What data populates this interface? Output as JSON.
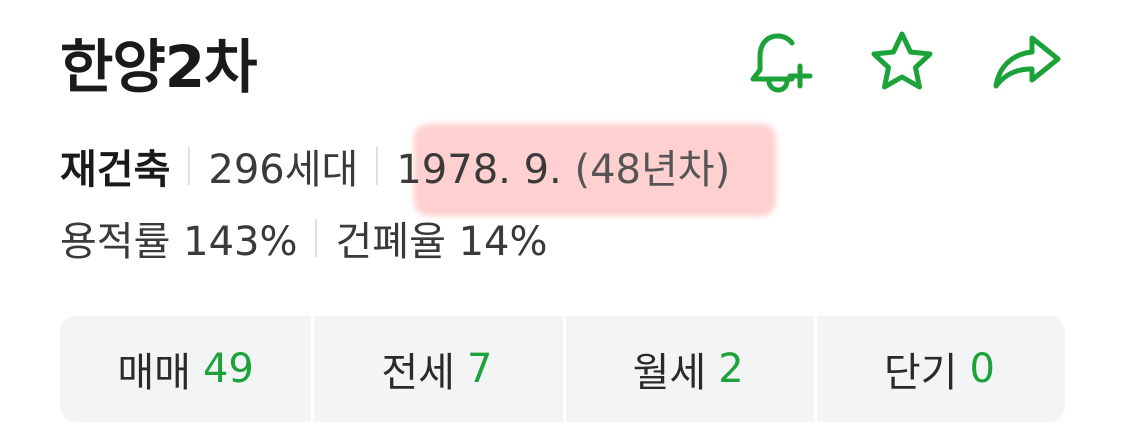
{
  "header": {
    "title": "한양2차",
    "icons": [
      "bell-plus-icon",
      "star-icon",
      "share-arrow-icon"
    ],
    "accent_color": "#1ba33a"
  },
  "info": {
    "type": "재건축",
    "households": "296세대",
    "built": "1978. 9.",
    "age": "(48년차)",
    "floor_area_ratio": "용적률 143%",
    "building_coverage": "건폐율 14%"
  },
  "tabs": [
    {
      "label": "매매",
      "count": "49"
    },
    {
      "label": "전세",
      "count": "7"
    },
    {
      "label": "월세",
      "count": "2"
    },
    {
      "label": "단기",
      "count": "0"
    }
  ]
}
